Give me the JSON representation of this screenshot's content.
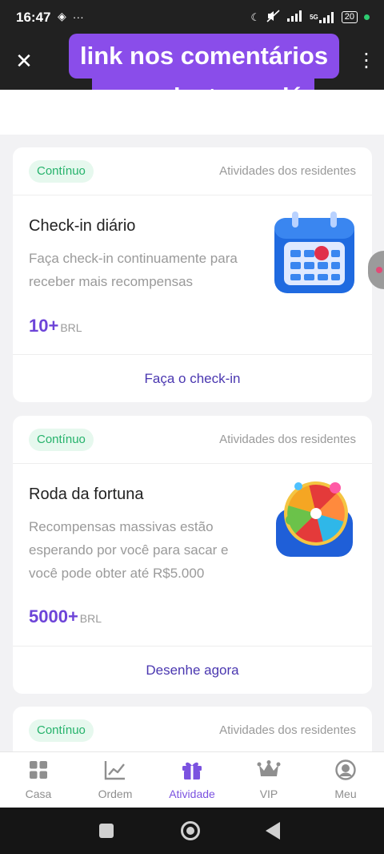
{
  "status_bar": {
    "time": "16:47",
    "left_icons": [
      "layers-icon",
      "more-dots-icon"
    ],
    "right_icons": [
      "moon-icon",
      "mute-icon",
      "signal-icon",
      "signal-5g-icon",
      "battery-icon"
    ],
    "network": "5G",
    "battery": "20"
  },
  "top_bar": {
    "close_icon": "close-icon",
    "more_icon": "kebab-icon"
  },
  "overlay": {
    "line1": "link nos comentários",
    "line2": "se cadastre-se já"
  },
  "cards": [
    {
      "tag": "Contínuo",
      "scope": "Atividades dos residentes",
      "title": "Check-in diário",
      "desc_lines": [
        "Faça check-in continuamente para",
        "receber mais recompensas"
      ],
      "amount": "10+",
      "unit": "BRL",
      "action": "Faça o check-in",
      "illustration": "calendar-icon"
    },
    {
      "tag": "Contínuo",
      "scope": "Atividades dos residentes",
      "title": "Roda da fortuna",
      "desc_lines": [
        "Recompensas massivas estão",
        "esperando por você para sacar e",
        "você pode obter até R$5.000"
      ],
      "amount": "5000+",
      "unit": "BRL",
      "action": "Desenhe agora",
      "illustration": "fortune-wheel-icon"
    },
    {
      "tag": "Contínuo",
      "scope": "Atividades dos residentes"
    }
  ],
  "tabbar": [
    {
      "label": "Casa",
      "icon": "grid-icon"
    },
    {
      "label": "Ordem",
      "icon": "chart-icon"
    },
    {
      "label": "Atividade",
      "icon": "gift-icon",
      "active": true
    },
    {
      "label": "VIP",
      "icon": "crown-icon"
    },
    {
      "label": "Meu",
      "icon": "user-icon"
    }
  ],
  "colors": {
    "accent": "#7b52e0",
    "amount": "#6d44d8",
    "tag_text": "#25b26b",
    "tag_bg": "#e6f8ee",
    "overlay_bg": "#8a4dea"
  }
}
